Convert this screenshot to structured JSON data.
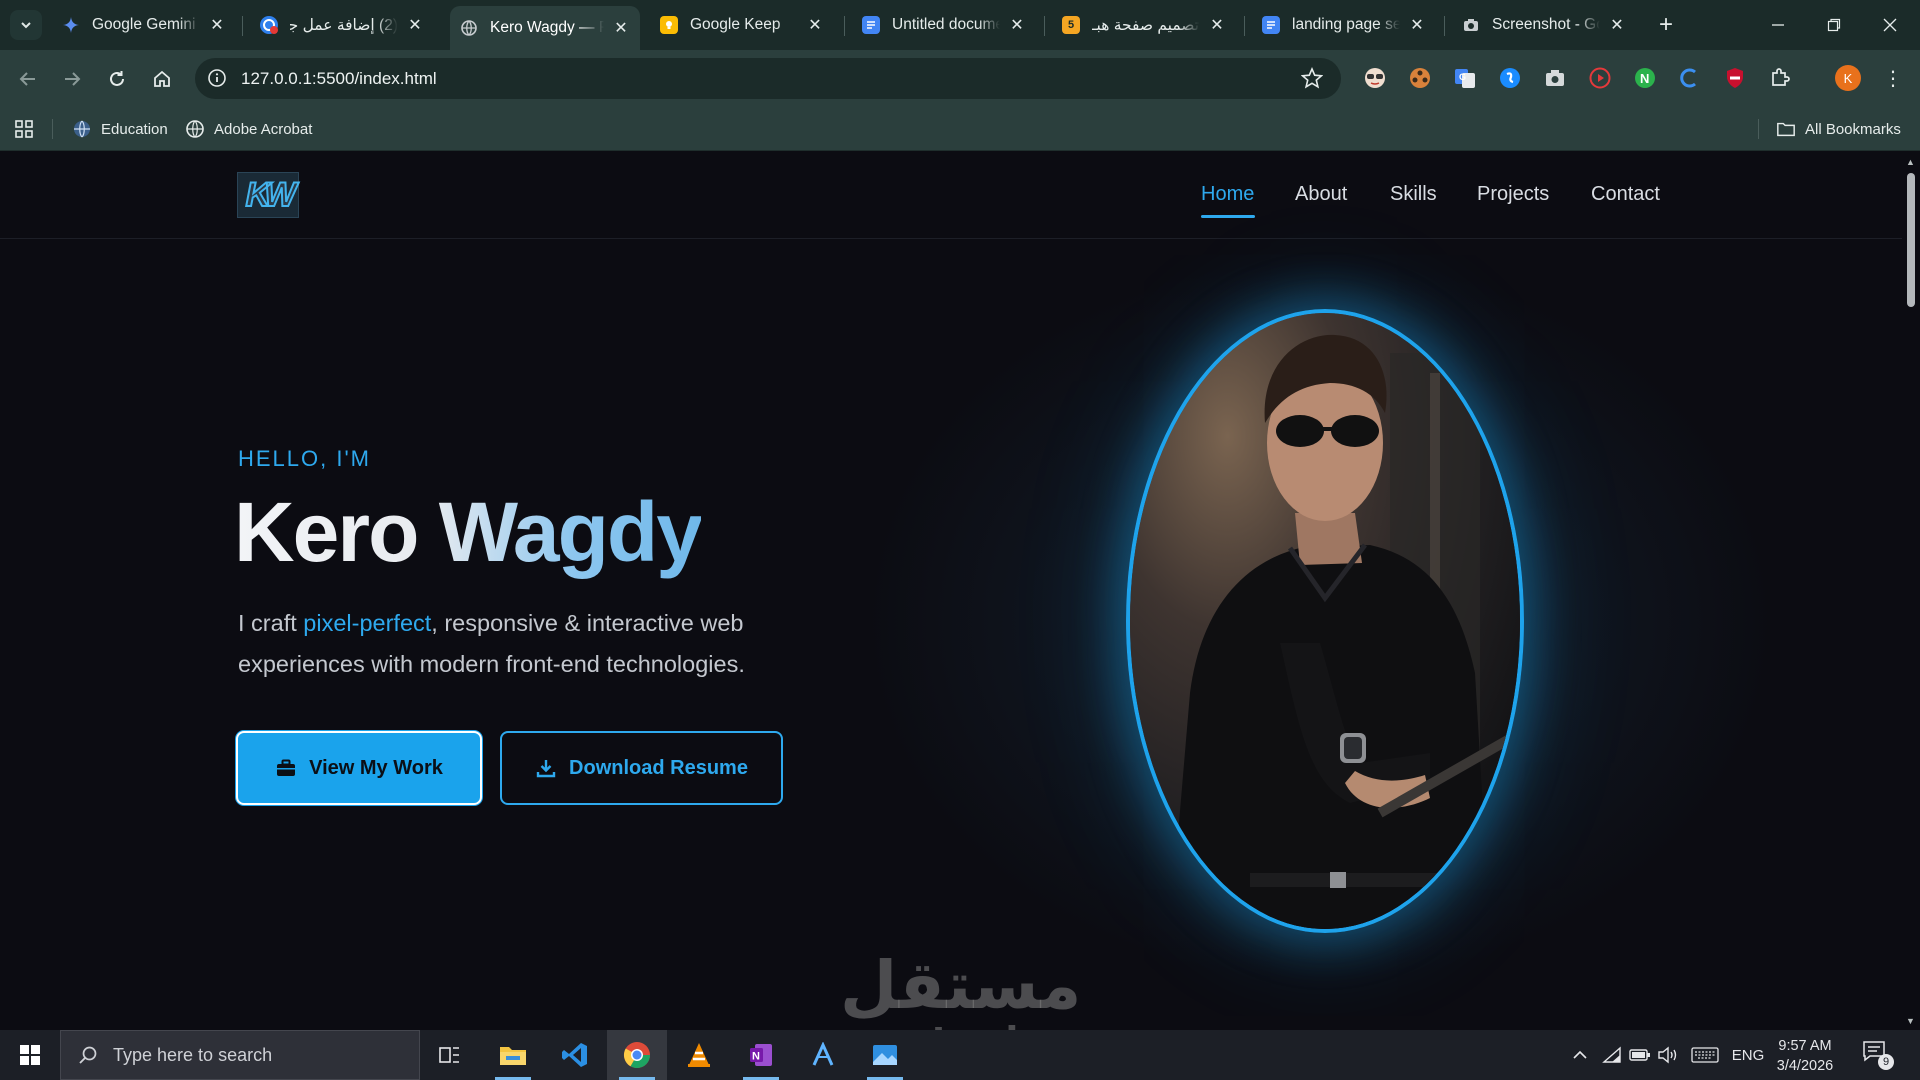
{
  "browser": {
    "tabs": [
      {
        "title": "Google Gemini",
        "favicon": "gemini-icon",
        "color": "#8ab4f8"
      },
      {
        "title": "(2) إضافة عمل جـ",
        "favicon": "mostaql-icon",
        "color": "#2f80ed"
      },
      {
        "title": "Kero Wagdy — P",
        "favicon": "globe-icon",
        "color": "#9aa0a6"
      },
      {
        "title": "Google Keep",
        "favicon": "keep-icon",
        "color": "#fbbc04"
      },
      {
        "title": "Untitled docume",
        "favicon": "docs-icon",
        "color": "#4285f4"
      },
      {
        "title": "تصميم صفحة هبـ",
        "favicon": "five-icon",
        "color": "#f5a623"
      },
      {
        "title": "landing page ser",
        "favicon": "docs-icon",
        "color": "#4285f4"
      },
      {
        "title": "Screenshot - Goo",
        "favicon": "camera-icon",
        "color": "#c8cdd0"
      }
    ],
    "active_tab_index": 2,
    "url": "127.0.0.1:5500/index.html",
    "bookmarks": [
      {
        "label": "Education",
        "icon": "globe-icon"
      },
      {
        "label": "Adobe Acrobat",
        "icon": "acrobat-icon"
      }
    ],
    "all_bookmarks_label": "All Bookmarks",
    "profile_initial": "K",
    "extensions": [
      "extension-face-icon",
      "extension-reel-icon",
      "google-translate-icon",
      "shazam-icon",
      "screenshot-icon",
      "video-record-icon",
      "extension-n-icon",
      "extension-c-icon",
      "block-icon",
      "puzzle-icon"
    ]
  },
  "site": {
    "logo_text": "KW",
    "nav": [
      {
        "label": "Home",
        "active": true
      },
      {
        "label": "About",
        "active": false
      },
      {
        "label": "Skills",
        "active": false
      },
      {
        "label": "Projects",
        "active": false
      },
      {
        "label": "Contact",
        "active": false
      }
    ],
    "hero": {
      "eyebrow": "HELLO, I'M",
      "name": "Kero Wagdy",
      "tagline_pre": "I craft ",
      "tagline_highlight": "pixel-perfect",
      "tagline_post": ", responsive & interactive web experiences with modern front-end technologies.",
      "primary_button": "View My Work",
      "secondary_button": "Download Resume"
    },
    "accent_color": "#2ea9ee",
    "watermark_ar": "مستقل",
    "watermark_en": "mostaql.com"
  },
  "taskbar": {
    "search_placeholder": "Type here to search",
    "language": "ENG",
    "time": "9:57 AM",
    "date": "3/4/2026",
    "notification_count": "9"
  }
}
